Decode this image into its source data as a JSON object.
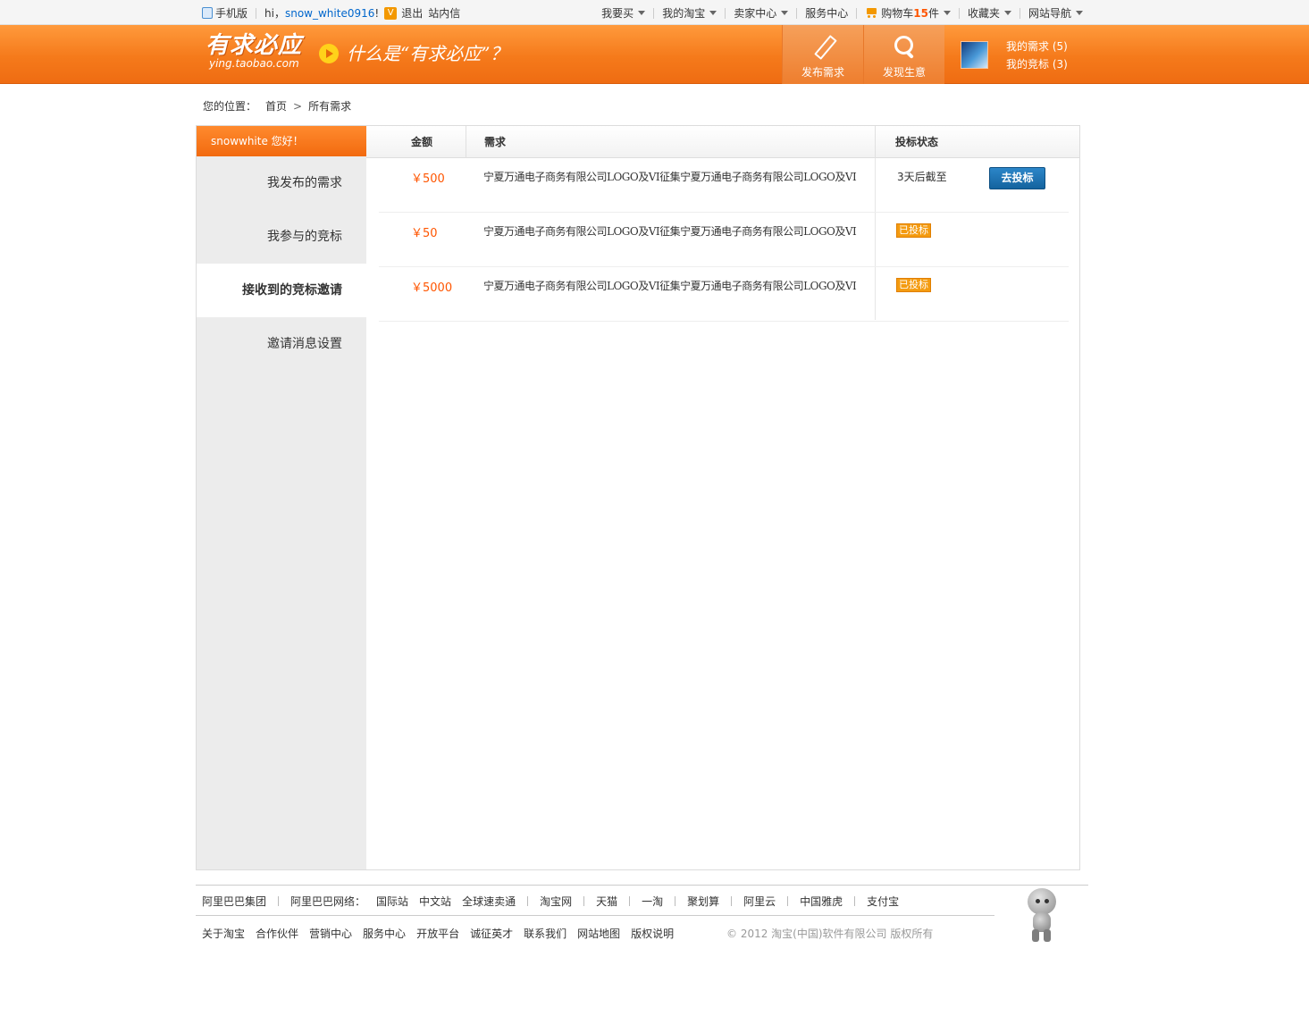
{
  "topbar": {
    "mobile": "手机版",
    "hi": "hi，",
    "username": "snow_white0916",
    "exclaim": "!",
    "logout": "退出",
    "messages": "站内信",
    "menus": [
      "我要买",
      "我的淘宝",
      "卖家中心"
    ],
    "service": "服务中心",
    "cart_label": "购物车",
    "cart_count": "15",
    "cart_unit": "件",
    "favorites": "收藏夹",
    "site_nav": "网站导航"
  },
  "header": {
    "logo_cn": "有求必应",
    "logo_en": "ying.taobao.com",
    "slogan": "什么是“有求必应”？",
    "publish": "发布需求",
    "discover": "发现生意",
    "my_demand": "我的需求 (5)",
    "my_bids": "我的竞标 (3)"
  },
  "breadcrumb": {
    "label": "您的位置：",
    "home": "首页",
    "current": "所有需求"
  },
  "sidebar": {
    "greeting": "snowwhite  您好！",
    "items": [
      {
        "label": "我发布的需求"
      },
      {
        "label": "我参与的竞标"
      },
      {
        "label": "接收到的竞标邀请",
        "active": true
      },
      {
        "label": "邀请消息设置"
      }
    ]
  },
  "table": {
    "headers": {
      "amount": "金额",
      "demand": "需求",
      "status": "投标状态"
    },
    "rows": [
      {
        "amount": "￥500",
        "demand": "宁夏万通电子商务有限公司LOGO及VI征集宁夏万通电子商务有限公司LOGO及VI",
        "status": "3天后截至",
        "action": "去投标"
      },
      {
        "amount": "￥50",
        "demand": "宁夏万通电子商务有限公司LOGO及VI征集宁夏万通电子商务有限公司LOGO及VI",
        "status": "已投标"
      },
      {
        "amount": "￥5000",
        "demand": "宁夏万通电子商务有限公司LOGO及VI征集宁夏万通电子商务有限公司LOGO及VI",
        "status": "已投标"
      }
    ]
  },
  "footer": {
    "group": "阿里巴巴集团",
    "network_label": "阿里巴巴网络：",
    "network_a": [
      "国际站",
      "中文站",
      "全球速卖通"
    ],
    "network_b": [
      "淘宝网",
      "天猫",
      "一淘",
      "聚划算",
      "阿里云",
      "中国雅虎",
      "支付宝"
    ],
    "links": [
      "关于淘宝",
      "合作伙伴",
      "营销中心",
      "服务中心",
      "开放平台",
      "诚征英才",
      "联系我们",
      "网站地图",
      "版权说明"
    ],
    "copyright": "© 2012 淘宝(中国)软件有限公司 版权所有"
  },
  "colors": {
    "brand_orange": "#f57a1b",
    "price_orange": "#ff5500",
    "button_blue": "#14639e",
    "badge_orange": "#f49b10"
  }
}
